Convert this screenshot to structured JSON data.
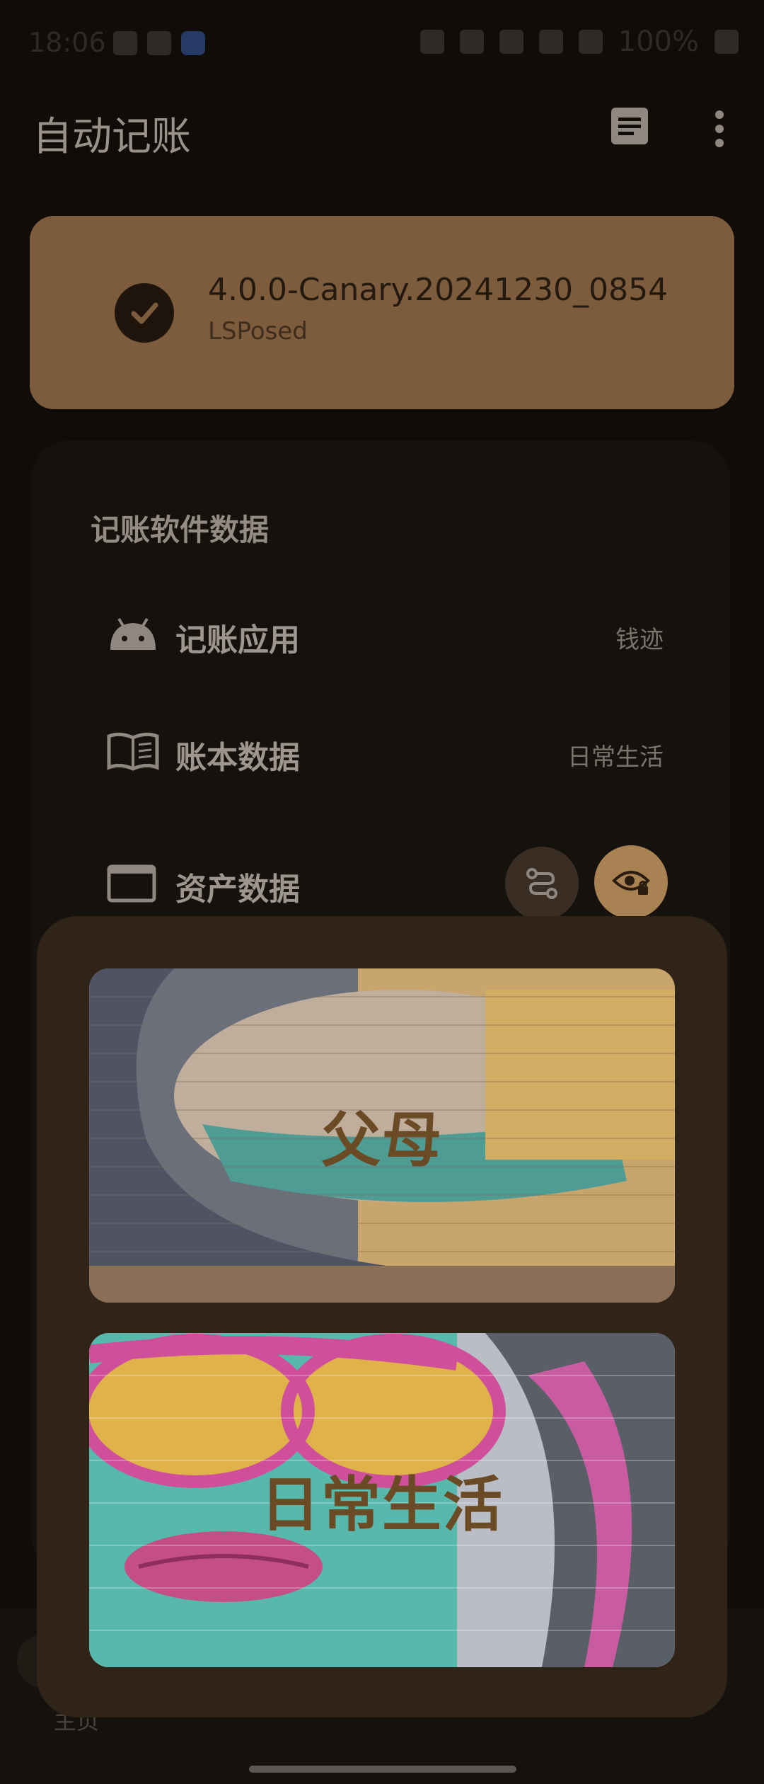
{
  "status_bar": {
    "time": "18:06",
    "battery": "100%"
  },
  "app_bar": {
    "title": "自动记账"
  },
  "status_card": {
    "version": "4.0.0-Canary.20241230_0854",
    "framework": "LSPosed"
  },
  "data_section": {
    "title": "记账软件数据",
    "rows": [
      {
        "label": "记账应用",
        "value": "钱迹",
        "icon": "android-icon"
      },
      {
        "label": "账本数据",
        "value": "日常生活",
        "icon": "book-icon"
      },
      {
        "label": "资产数据",
        "value": "",
        "icon": "wallet-icon"
      }
    ]
  },
  "dialog": {
    "books": [
      {
        "name": "父母"
      },
      {
        "name": "日常生活"
      }
    ]
  },
  "bottom_nav": {
    "home_label": "主页"
  },
  "colors": {
    "accent": "#a98253",
    "card": "#7c5c3c",
    "dialog": "#2f2417"
  }
}
